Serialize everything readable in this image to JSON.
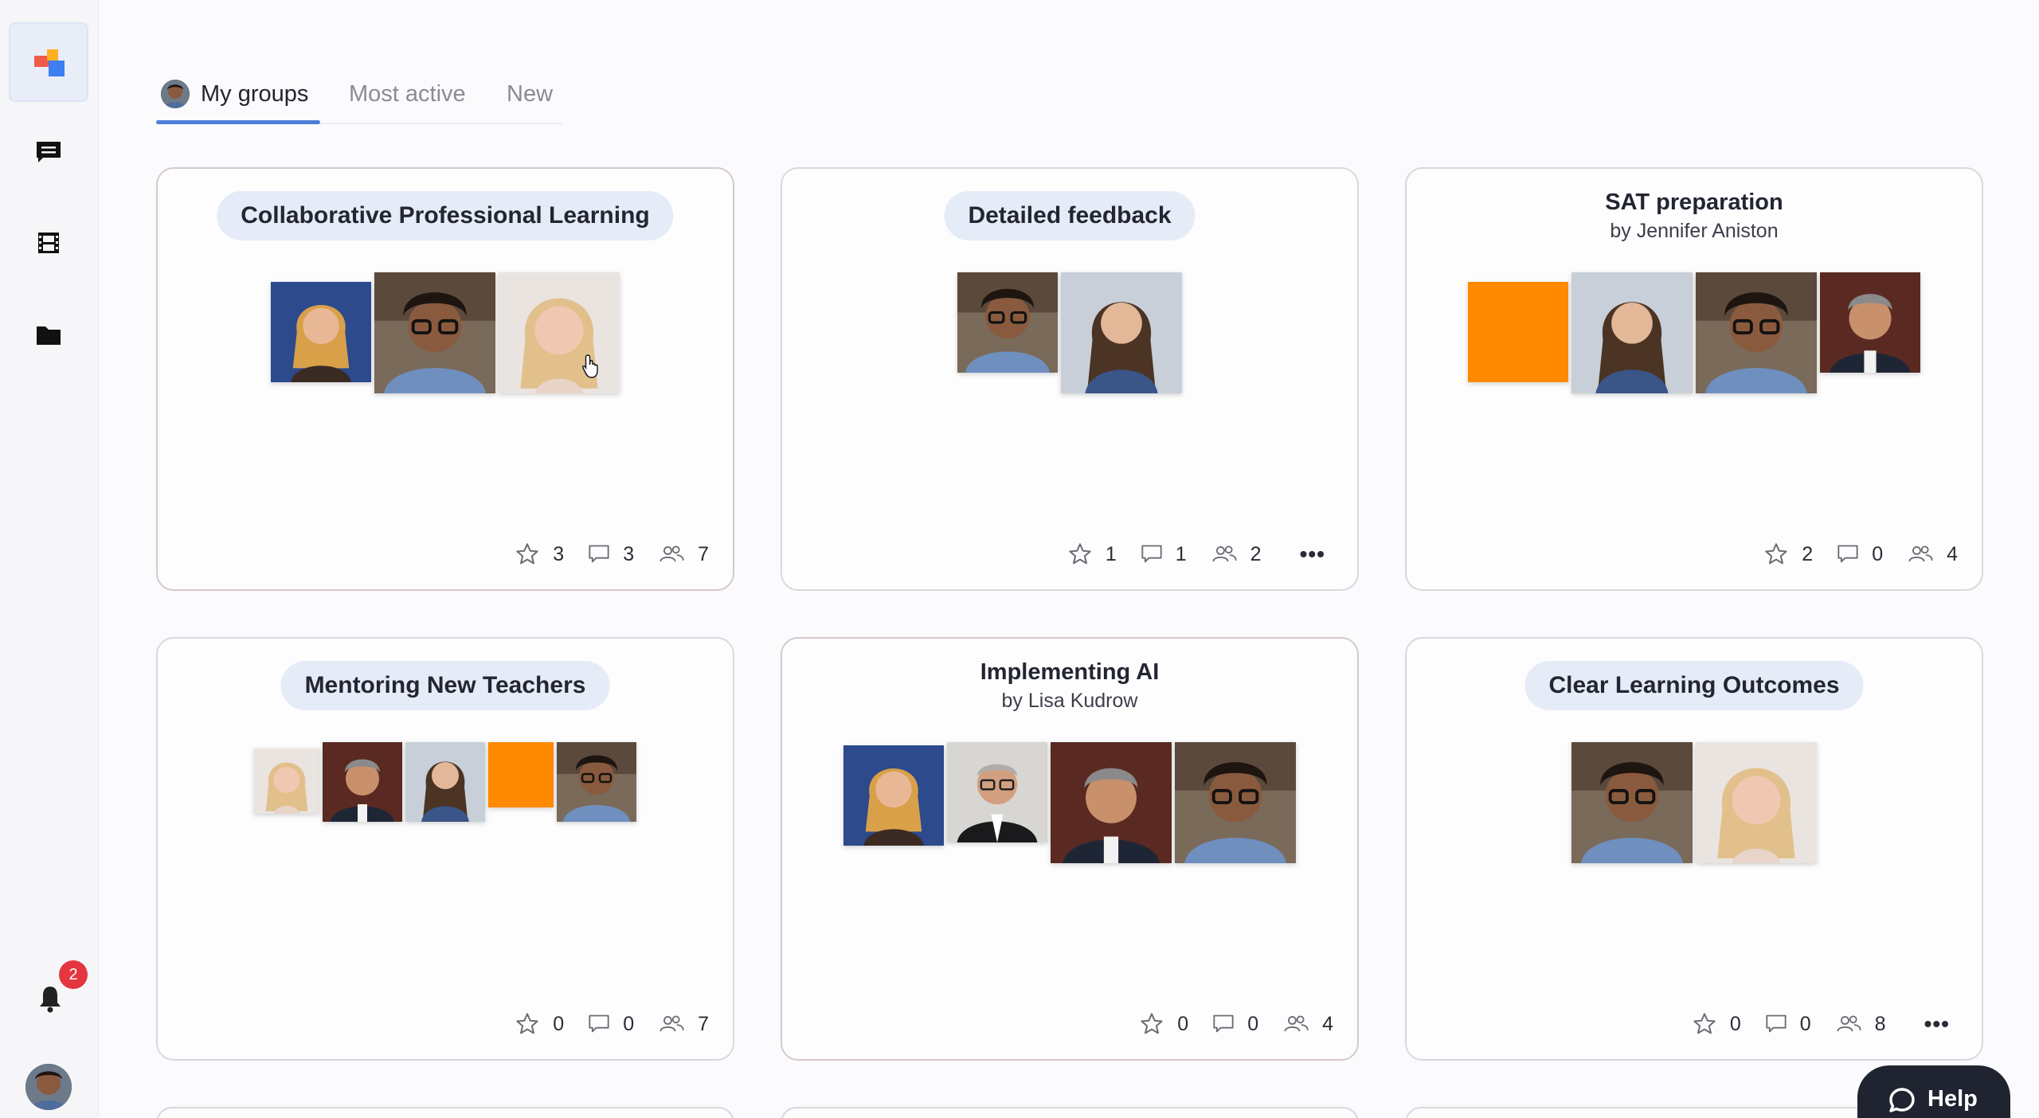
{
  "sidebar": {
    "notification_count": "2",
    "icons": [
      "app-logo-icon",
      "chat-icon",
      "film-icon",
      "folder-icon",
      "bell-icon",
      "user-avatar"
    ]
  },
  "tabs": [
    {
      "label": "My groups",
      "active": true
    },
    {
      "label": "Most active",
      "active": false
    },
    {
      "label": "New",
      "active": false
    }
  ],
  "cards": [
    {
      "title": "Collaborative Professional Learning",
      "style": "pill",
      "stars": "3",
      "comments": "3",
      "members": "7",
      "more": false,
      "photos": [
        "blonde-woman-blue",
        "man-glasses",
        "blonde-woman-light"
      ]
    },
    {
      "title": "Detailed feedback",
      "style": "pill",
      "stars": "1",
      "comments": "1",
      "members": "2",
      "more": true,
      "photos": [
        "man-glasses",
        "woman-brunette"
      ]
    },
    {
      "title": "SAT preparation",
      "subtitle": "by Jennifer Aniston",
      "style": "plain",
      "stars": "2",
      "comments": "0",
      "members": "4",
      "more": false,
      "photos": [
        "orange-square",
        "woman-brunette",
        "man-glasses",
        "man-grey-hair"
      ]
    },
    {
      "title": "Mentoring New Teachers",
      "style": "pill",
      "stars": "0",
      "comments": "0",
      "members": "7",
      "more": false,
      "photos": [
        "blonde-woman-light",
        "man-grey-hair",
        "woman-brunette",
        "orange-square",
        "man-glasses"
      ]
    },
    {
      "title": "Implementing AI",
      "subtitle": "by Lisa Kudrow",
      "style": "plain",
      "stars": "0",
      "comments": "0",
      "members": "4",
      "more": false,
      "photos": [
        "blonde-woman-blue",
        "man-older-glasses",
        "man-grey-hair",
        "man-glasses"
      ]
    },
    {
      "title": "Clear Learning Outcomes",
      "style": "pill",
      "stars": "0",
      "comments": "0",
      "members": "8",
      "more": true,
      "photos": [
        "man-glasses",
        "blonde-woman-light"
      ]
    }
  ],
  "help_label": "Help",
  "colors": {
    "accent": "#4c7fd9",
    "badge": "#e5353f",
    "orange": "#ff8a00",
    "pill": "#e6ebf8"
  }
}
